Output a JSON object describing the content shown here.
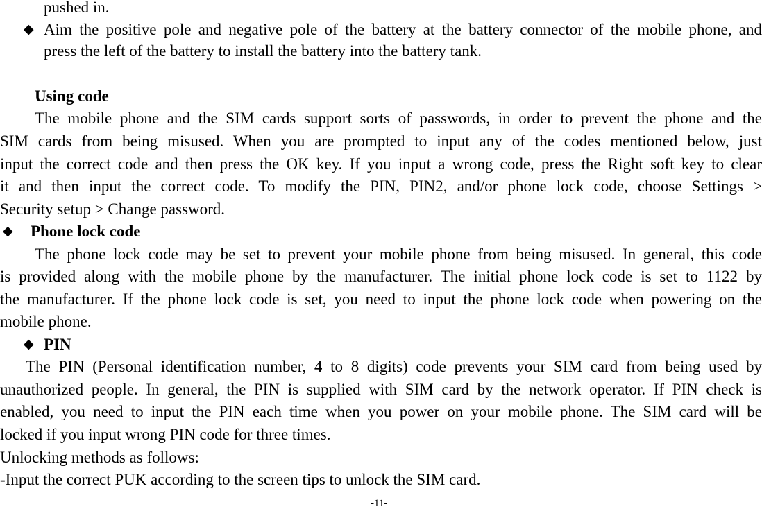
{
  "page_number": "-11-",
  "bullet_icon": "diamond-bullet",
  "intro": {
    "line0": "pushed in.",
    "bullet": {
      "line1": "Aim the positive pole and negative pole of the battery at the battery connector of the mobile phone, and",
      "line2": "press the left of the battery to install the battery into the battery tank."
    }
  },
  "using_code": {
    "heading": "Using code",
    "lines": [
      "The mobile phone and the SIM cards support sorts of passwords, in order to prevent the phone and the",
      "SIM cards from being misused. When you are prompted to input any of the codes mentioned below, just",
      "input the correct code and then press the OK key. If you input a wrong code, press the Right soft key to clear",
      "it and then input the correct code. To modify the PIN, PIN2, and/or phone lock code, choose Settings >",
      "Security setup > Change password."
    ]
  },
  "phone_lock": {
    "heading": "Phone lock code",
    "lines": [
      "The phone lock code may be set to prevent your mobile phone from being misused. In general, this code",
      "is provided along with the mobile phone by the manufacturer. The initial phone lock code is set to 1122 by",
      "the manufacturer. If the phone lock code is set, you need to input the phone lock code when powering on the",
      "mobile phone."
    ]
  },
  "pin": {
    "heading": "PIN",
    "lines": [
      "The PIN (Personal identification number, 4 to 8 digits) code prevents your SIM card from being used by",
      "unauthorized people. In general, the PIN is supplied with SIM card by the network operator. If PIN check is",
      "enabled, you need to input the PIN each time when you power on your mobile phone. The SIM card will be",
      "locked if you input wrong PIN code for three times.",
      "Unlocking methods as follows:",
      "-Input the correct PUK according to the screen tips to unlock the SIM card."
    ]
  }
}
